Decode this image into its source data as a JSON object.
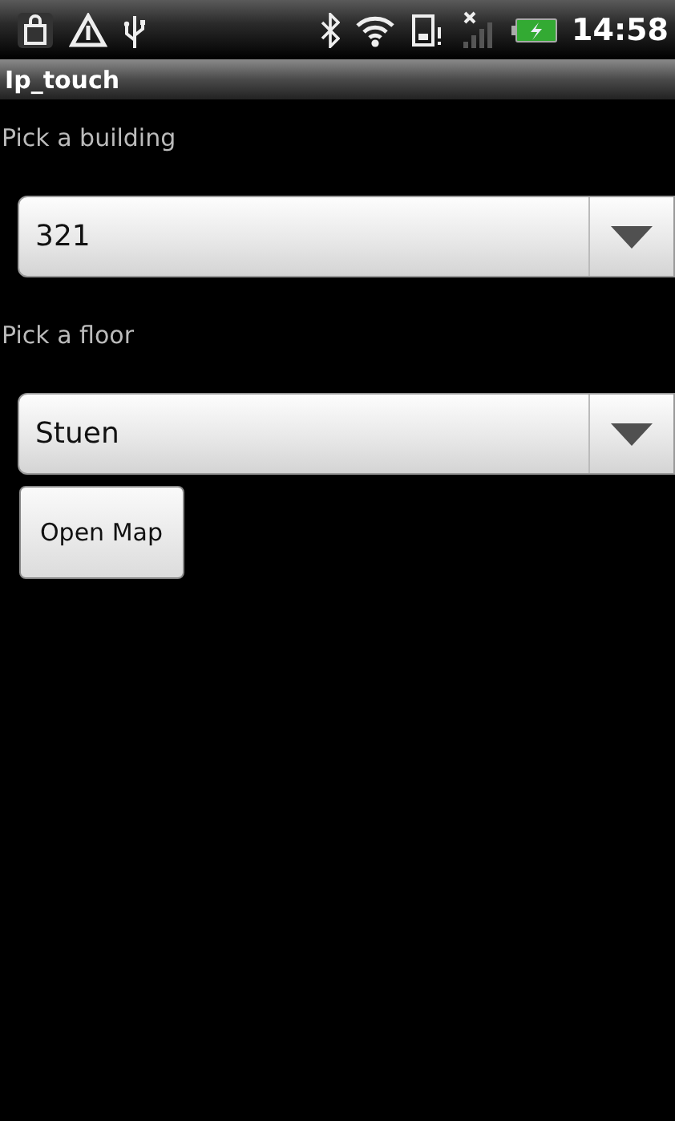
{
  "status_bar": {
    "time": "14:58"
  },
  "window": {
    "title": "Ip_touch"
  },
  "fields": [
    {
      "label": "Pick a building",
      "value": "321"
    },
    {
      "label": "Pick a floor",
      "value": "Stuen"
    }
  ],
  "buttons": [
    "Open Map"
  ]
}
